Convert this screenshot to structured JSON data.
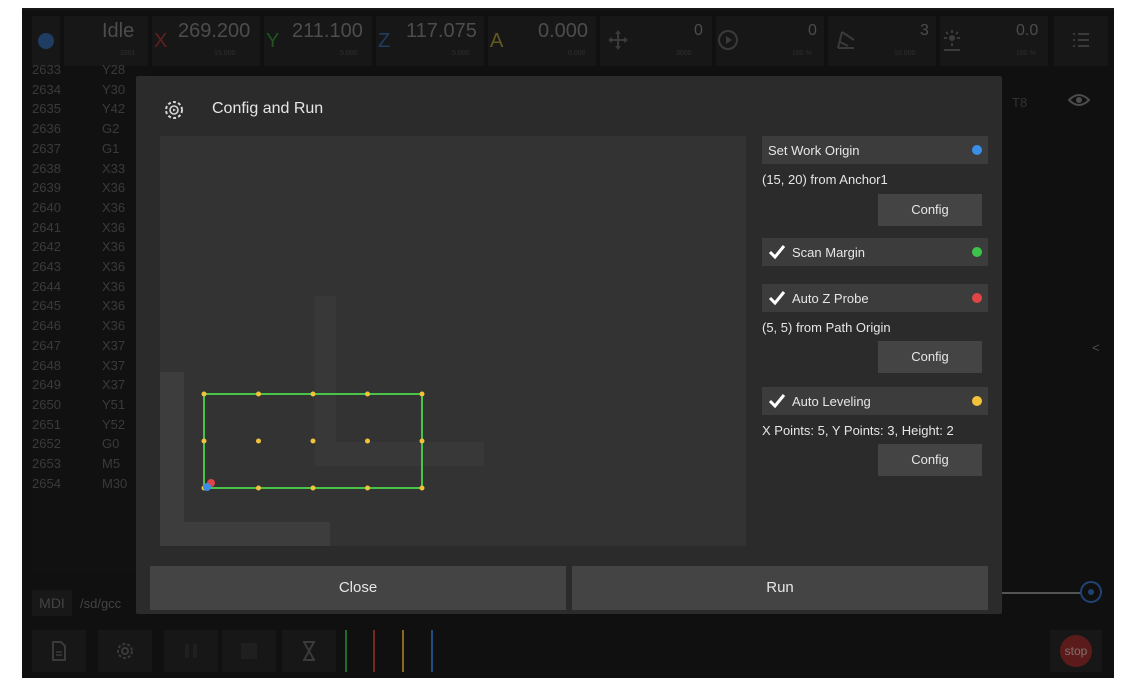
{
  "topbar": {
    "state": "Idle",
    "state_sub": "3301",
    "x_value": "269.200",
    "x_sub": "15.000",
    "y_value": "211.100",
    "y_sub": "5.000",
    "z_value": "117.075",
    "z_sub": "5.000",
    "a_value": "0.000",
    "a_sub": "0.000",
    "x_label": "X",
    "y_label": "Y",
    "z_label": "Z",
    "a_label": "A",
    "jog_value": "0",
    "jog_sub": "3000",
    "feed_value": "0",
    "feed_sub": "100 %",
    "spindle_value": "3",
    "spindle_sub": "10.000",
    "laser_value": "0.0",
    "laser_sub": "100 %"
  },
  "gcode": {
    "lines": [
      {
        "num": "2633",
        "cmd": "Y28"
      },
      {
        "num": "2634",
        "cmd": "Y30"
      },
      {
        "num": "2635",
        "cmd": "Y42"
      },
      {
        "num": "2636",
        "cmd": "G2"
      },
      {
        "num": "2637",
        "cmd": "G1"
      },
      {
        "num": "2638",
        "cmd": "X33"
      },
      {
        "num": "2639",
        "cmd": "X36"
      },
      {
        "num": "2640",
        "cmd": "X36"
      },
      {
        "num": "2641",
        "cmd": "X36"
      },
      {
        "num": "2642",
        "cmd": "X36"
      },
      {
        "num": "2643",
        "cmd": "X36"
      },
      {
        "num": "2644",
        "cmd": "X36"
      },
      {
        "num": "2645",
        "cmd": "X36"
      },
      {
        "num": "2646",
        "cmd": "X36"
      },
      {
        "num": "2647",
        "cmd": "X37"
      },
      {
        "num": "2648",
        "cmd": "X37"
      },
      {
        "num": "2649",
        "cmd": "X37"
      },
      {
        "num": "2650",
        "cmd": "Y51"
      },
      {
        "num": "2651",
        "cmd": "Y52"
      },
      {
        "num": "2652",
        "cmd": "G0"
      },
      {
        "num": "2653",
        "cmd": "M5"
      },
      {
        "num": "2654",
        "cmd": "M30"
      }
    ]
  },
  "right": {
    "tool": "T8",
    "collapse": "<"
  },
  "mdi": {
    "label": "MDI",
    "path": "/sd/gcc"
  },
  "stop_label": "stop",
  "colors": {
    "blue": "#3a8ee6",
    "green": "#3cc44a",
    "red": "#e04444",
    "yellow": "#f2c23a",
    "path": "#48c448"
  },
  "modal": {
    "title": "Config and Run",
    "icon": "gear-play-icon",
    "options": [
      {
        "label": "Set Work Origin",
        "desc": "(15, 20) from Anchor1",
        "checked": null,
        "button": "Config",
        "dot": "blue"
      },
      {
        "label": "Scan Margin",
        "desc": "",
        "checked": true,
        "button": "",
        "dot": "green"
      },
      {
        "label": "Auto Z Probe",
        "desc": "(5, 5) from Path Origin",
        "checked": true,
        "button": "Config",
        "dot": "red"
      },
      {
        "label": "Auto Leveling",
        "desc": "X Points: 5, Y Points: 3, Height: 2",
        "checked": true,
        "button": "Config",
        "dot": "yellow"
      }
    ],
    "close_label": "Close",
    "run_label": "Run"
  }
}
